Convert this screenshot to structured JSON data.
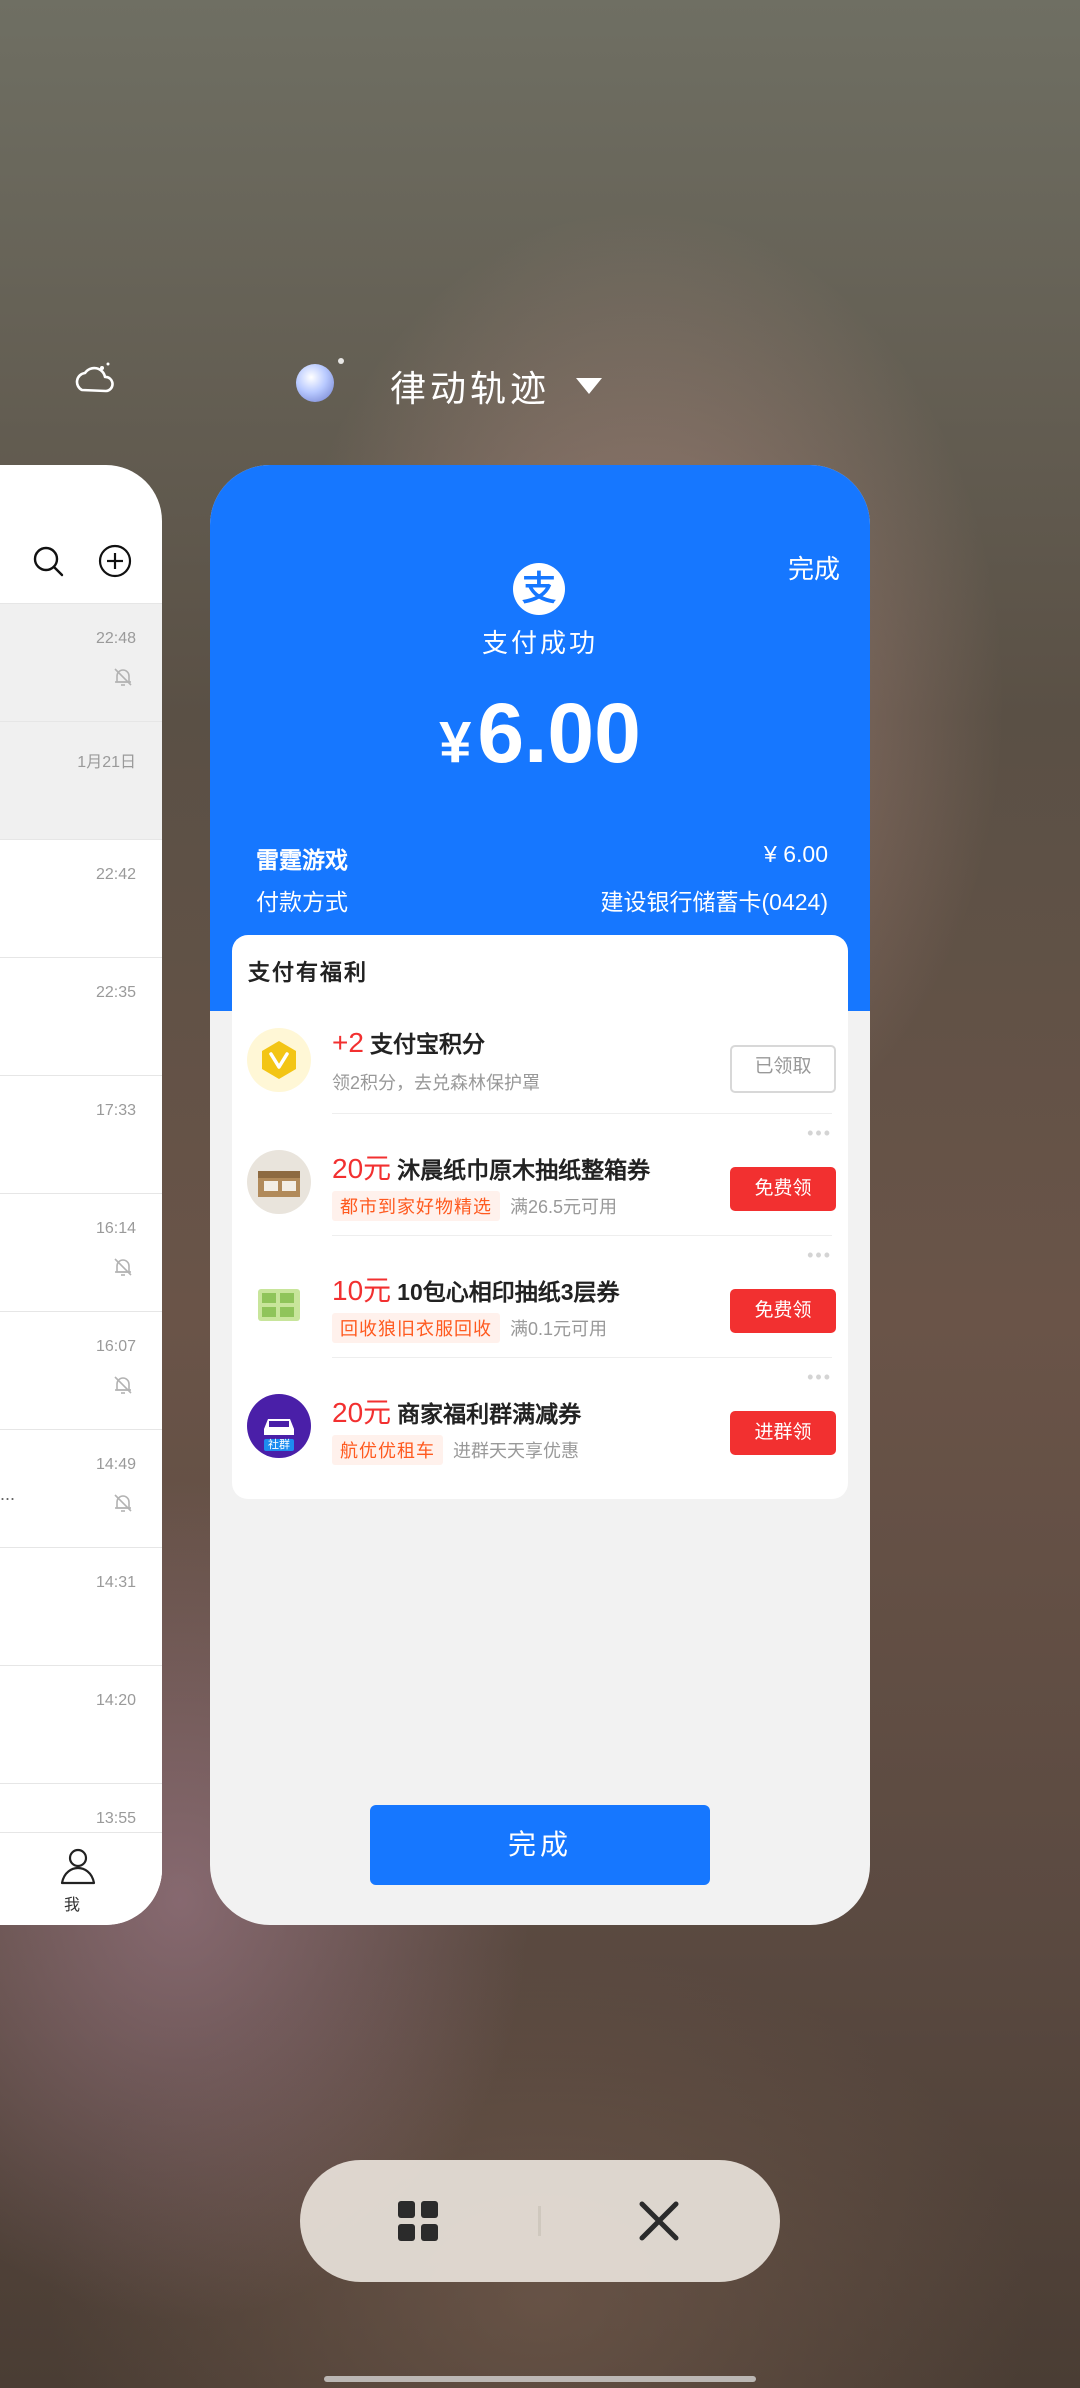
{
  "recent_apps": {
    "app_title": "律动轨迹",
    "icons": {
      "weather": "weather-icon",
      "app": "app-icon",
      "caret": "caret-down-icon"
    }
  },
  "left_card": {
    "header_icons": [
      "search-icon",
      "add-circle-icon"
    ],
    "rows": [
      {
        "time": "22:48",
        "muted": true,
        "shaded": true
      },
      {
        "time": "1月21日",
        "muted": false,
        "shaded": true
      },
      {
        "time": "22:42",
        "muted": false,
        "shaded": false
      },
      {
        "time": "22:35",
        "muted": false,
        "shaded": false
      },
      {
        "time": "17:33",
        "muted": false,
        "shaded": false
      },
      {
        "time": "16:14",
        "muted": true,
        "shaded": false
      },
      {
        "time": "16:07",
        "muted": true,
        "shaded": false
      },
      {
        "time": "14:49",
        "muted": true,
        "shaded": false,
        "snippet": "..."
      },
      {
        "time": "14:31",
        "muted": false,
        "shaded": false
      },
      {
        "time": "14:20",
        "muted": false,
        "shaded": false
      },
      {
        "time": "13:55",
        "muted": false,
        "shaded": false
      }
    ],
    "tab_me": "我"
  },
  "payment": {
    "done_top": "完成",
    "logo_char": "支",
    "status": "支付成功",
    "currency": "¥",
    "amount": "6.00",
    "merchant_label": "雷霆游戏",
    "merchant_amount": "¥ 6.00",
    "method_label": "付款方式",
    "method_value": "建设银行储蓄卡(0424)",
    "done_button": "完成",
    "brand_color": "#1677ff"
  },
  "benefits": {
    "title": "支付有福利",
    "items": [
      {
        "highlight": "+2",
        "title": "支付宝积分",
        "tag": "",
        "desc": "领2积分，去兑森林保护罩",
        "button": "已领取",
        "button_style": "grey",
        "icon": "points-v-icon"
      },
      {
        "highlight": "20元",
        "title": "沐晨纸巾原木抽纸整箱券",
        "tag": "都市到家好物精选",
        "desc": "满26.5元可用",
        "button": "免费领",
        "button_style": "red",
        "icon": "tissue-box-icon"
      },
      {
        "highlight": "10元",
        "title": "10包心相印抽纸3层券",
        "tag": "回收狼旧衣服回收",
        "desc": "满0.1元可用",
        "button": "免费领",
        "button_style": "red",
        "icon": "tissue-pack-icon"
      },
      {
        "highlight": "20元",
        "title": "商家福利群满减券",
        "tag": "航优优租车",
        "desc": "进群天天享优惠",
        "button": "进群领",
        "button_style": "red",
        "icon": "car-community-icon",
        "icon_badge": "社群"
      }
    ],
    "accent_red": "#f23030"
  },
  "controls": {
    "icons": [
      "grid-icon",
      "close-icon"
    ]
  }
}
